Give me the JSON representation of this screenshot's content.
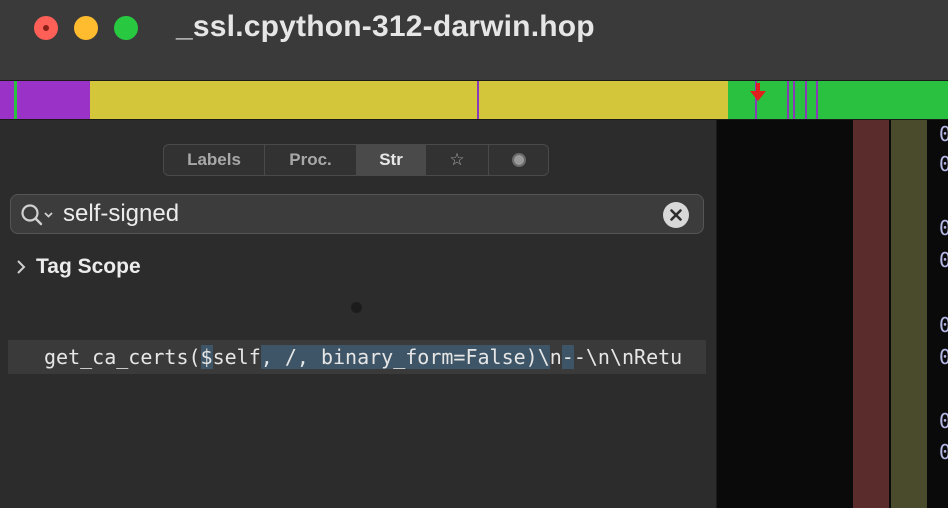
{
  "window": {
    "title": "_ssl.cpython-312-darwin.hop"
  },
  "colors": {
    "nav_purple": "#9b32c8",
    "nav_yellow": "#d4c63a",
    "nav_green": "#2ac040",
    "nav_marker": "#8a3ab8",
    "cursor_red": "#e0201c"
  },
  "tabs": [
    {
      "label": "Labels"
    },
    {
      "label": "Proc."
    },
    {
      "label": "Str"
    },
    {
      "label": "☆"
    },
    {
      "label": "",
      "icon": "circle-icon"
    }
  ],
  "search": {
    "value": "self-signed",
    "placeholder": ""
  },
  "tag_scope": {
    "label": "Tag Scope"
  },
  "result": {
    "parts": [
      "get_ca_certs(",
      "$",
      "self",
      ", /, binary_form=False)\\",
      "n",
      "-",
      "-\\n\\nRetu"
    ]
  },
  "hex_column": [
    "0",
    "0",
    "0",
    "0",
    "0",
    "0",
    "0",
    "0"
  ]
}
